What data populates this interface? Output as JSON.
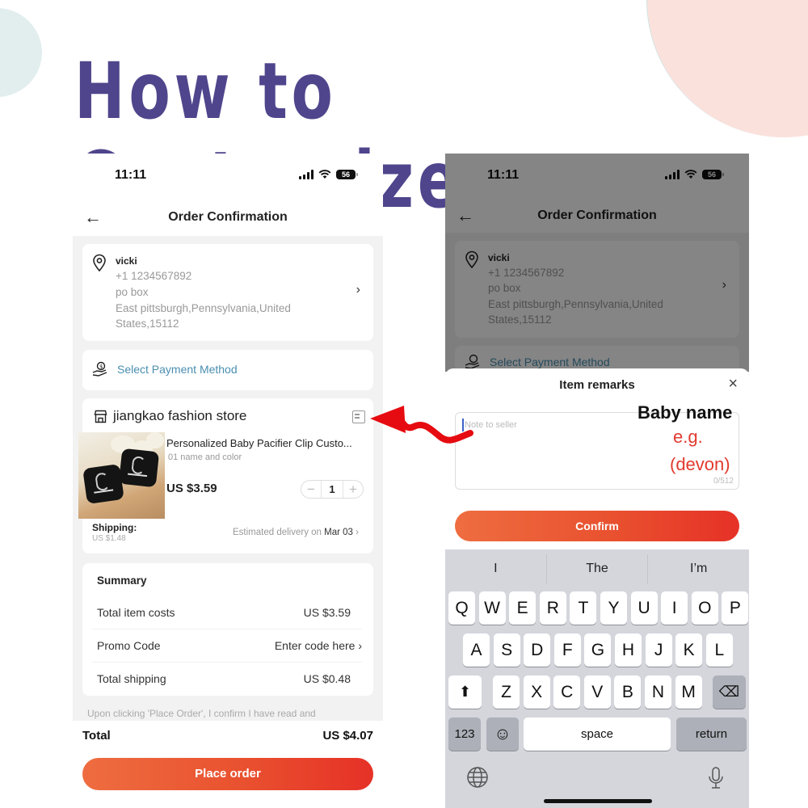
{
  "headline": "How to Customize",
  "left_phone": {
    "status": {
      "time": "11:11",
      "battery": "56"
    },
    "nav": {
      "title": "Order Confirmation"
    },
    "address": {
      "name": "vicki",
      "phone": "+1 1234567892",
      "line1": "po box",
      "line2": "East pittsburgh,Pennsylvania,United",
      "line3": "States,15112"
    },
    "payment": {
      "label": "Select Payment Method"
    },
    "store": {
      "name": "jiangkao fashion store",
      "product_title": "Personalized Baby Pacifier Clip Custo...",
      "variant": "01 name and color",
      "price": "US $3.59",
      "quantity": "1",
      "minus": "−",
      "plus": "+",
      "shipping_label": "Shipping:",
      "shipping_cost": "US $1.48",
      "eta_prefix": "Estimated delivery on",
      "eta_date": "Mar 03"
    },
    "summary": {
      "title": "Summary",
      "rows": [
        {
          "label": "Total item costs",
          "value": "US $3.59"
        },
        {
          "label": "Promo Code",
          "value": "Enter code here ›"
        },
        {
          "label": "Total shipping",
          "value": "US $0.48"
        }
      ]
    },
    "terms": "Upon clicking 'Place Order', I confirm I have read and",
    "total_label": "Total",
    "total_value": "US $4.07",
    "cta": "Place order"
  },
  "right_phone": {
    "status": {
      "time": "11:11",
      "battery": "56"
    },
    "nav": {
      "title": "Order Confirmation"
    },
    "address": {
      "name": "vicki",
      "phone": "+1 1234567892",
      "line1": "po box",
      "line2": "East pittsburgh,Pennsylvania,United",
      "line3": "States,15112"
    },
    "payment": {
      "label": "Select Payment Method"
    },
    "sheet": {
      "title": "Item remarks",
      "close": "×",
      "placeholder": "Note to seller",
      "counter": "0/512",
      "annotation_title": "Baby name",
      "annotation_eg": "e.g.",
      "annotation_example": "(devon)",
      "confirm": "Confirm"
    },
    "keyboard": {
      "suggestions": [
        "I",
        "The",
        "I’m"
      ],
      "row1": [
        "Q",
        "W",
        "E",
        "R",
        "T",
        "Y",
        "U",
        "I",
        "O",
        "P"
      ],
      "row2": [
        "A",
        "S",
        "D",
        "F",
        "G",
        "H",
        "J",
        "K",
        "L"
      ],
      "row3": [
        "Z",
        "X",
        "C",
        "V",
        "B",
        "N",
        "M"
      ],
      "shift": "⬆",
      "backspace": "⌫",
      "numbers": "123",
      "emoji": "☺",
      "space": "space",
      "return": "return"
    }
  },
  "colors": {
    "headline": "#4f458c",
    "accent": "#e9512f",
    "link": "#4a8fb0",
    "annotation_red": "#e23a2d"
  }
}
